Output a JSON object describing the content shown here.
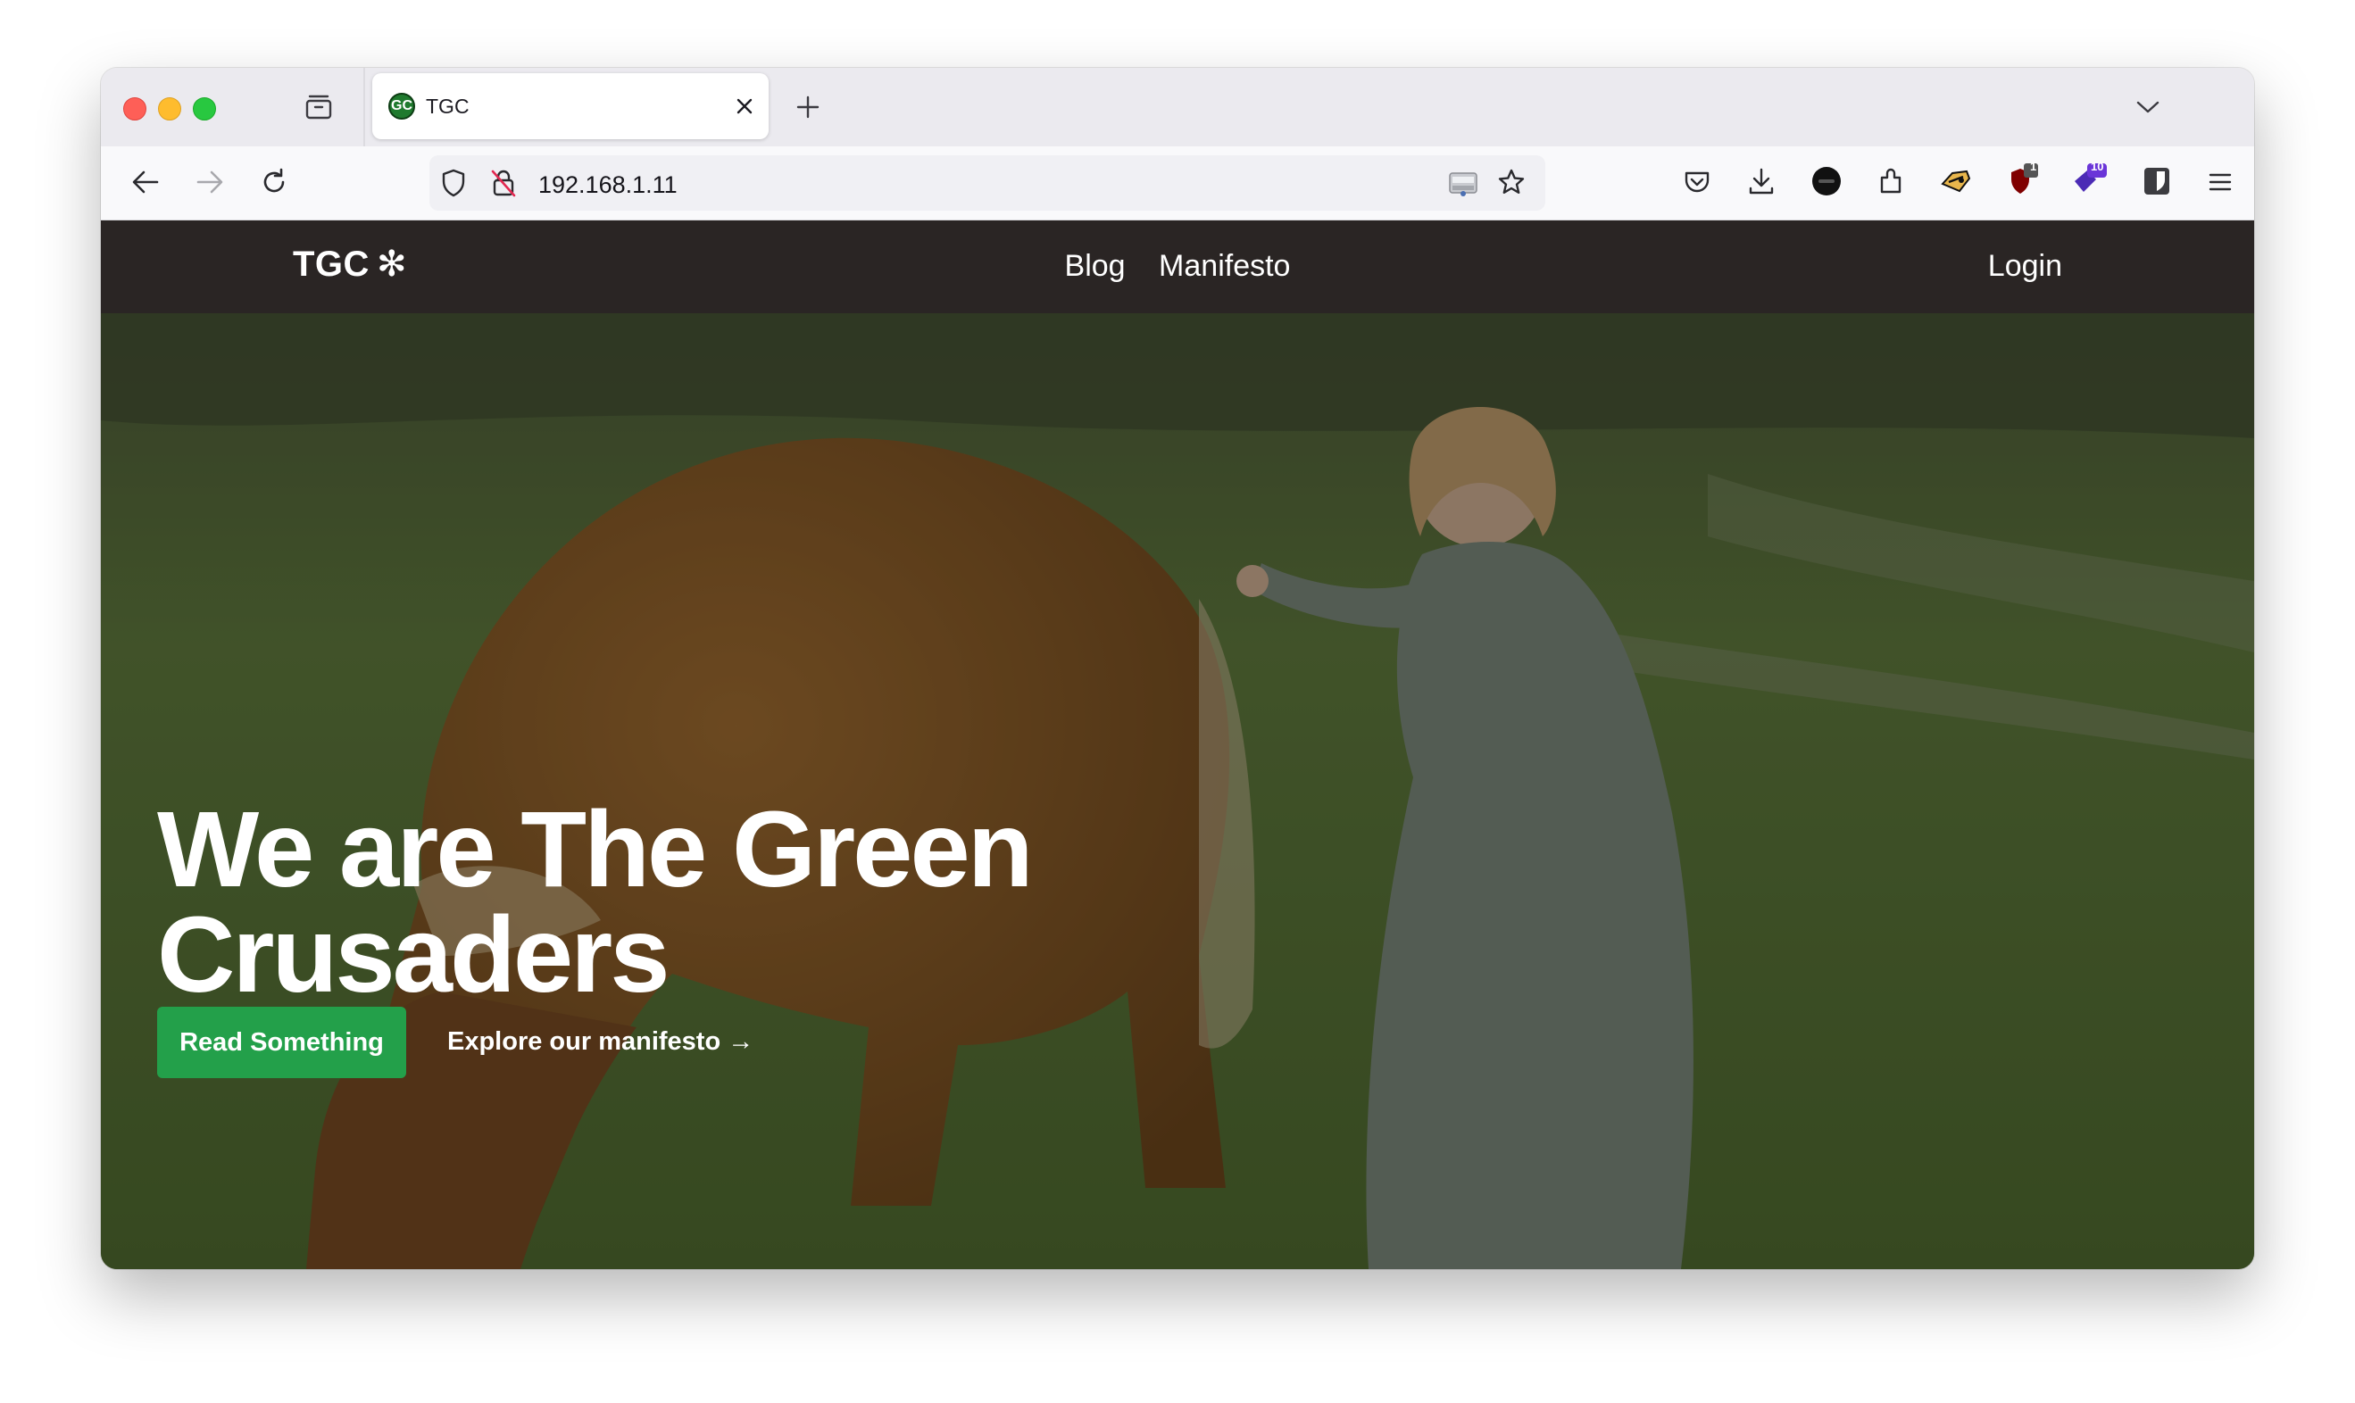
{
  "browser": {
    "tab": {
      "favicon_text": "GC",
      "title": "TGC"
    },
    "url": "192.168.1.11",
    "toolbar_badges": {
      "ublock": "1",
      "extension_purple": "10"
    }
  },
  "site": {
    "logo": "TGC",
    "logo_symbol": "✻",
    "nav": [
      "Blog",
      "Manifesto"
    ],
    "login": "Login"
  },
  "hero": {
    "title": "We are The Green Crusaders",
    "primary_button": "Read Something",
    "secondary_link": "Explore our manifesto",
    "secondary_arrow": "→"
  },
  "icons": {
    "traffic_lights": [
      "close",
      "minimize",
      "zoom"
    ],
    "tabstrip": [
      "tab-manager-icon",
      "close-tab-icon",
      "new-tab-icon",
      "tab-list-chevron-icon"
    ],
    "navigation": [
      "back-icon",
      "forward-icon",
      "reload-icon"
    ],
    "urlbar": [
      "shield-icon",
      "insecure-lock-icon",
      "reader-view-icon",
      "bookmark-star-icon"
    ],
    "toolbar": [
      "pocket-icon",
      "downloads-icon",
      "account-avatar-icon",
      "extensions-icon",
      "extension-mask-icon",
      "ublock-icon",
      "extension-purple-icon",
      "bitwarden-icon",
      "menu-icon"
    ]
  },
  "colors": {
    "header_bg": "#2a2524",
    "primary_button": "#23a04a",
    "hero_text": "#ffffff"
  }
}
